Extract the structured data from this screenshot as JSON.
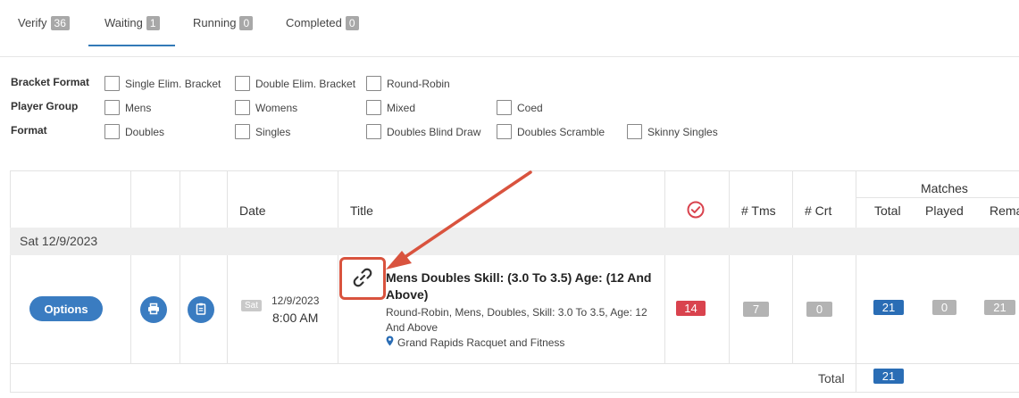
{
  "tabs": [
    {
      "label": "Verify",
      "count": "36"
    },
    {
      "label": "Waiting",
      "count": "1"
    },
    {
      "label": "Running",
      "count": "0"
    },
    {
      "label": "Completed",
      "count": "0"
    }
  ],
  "filters": {
    "bracket_format": {
      "label": "Bracket Format",
      "options": [
        "Single Elim. Bracket",
        "Double Elim. Bracket",
        "Round-Robin"
      ]
    },
    "player_group": {
      "label": "Player Group",
      "options": [
        "Mens",
        "Womens",
        "Mixed",
        "Coed"
      ]
    },
    "format": {
      "label": "Format",
      "options": [
        "Doubles",
        "Singles",
        "Doubles Blind Draw",
        "Doubles Scramble",
        "Skinny Singles"
      ]
    }
  },
  "table": {
    "headers": {
      "date": "Date",
      "title": "Title",
      "teams": "# Tms",
      "courts": "# Crt",
      "matches_group": "Matches",
      "total": "Total",
      "played": "Played",
      "remaining": "Remair"
    },
    "group_label": "Sat 12/9/2023",
    "row": {
      "options_label": "Options",
      "day": "Sat",
      "date": "12/9/2023",
      "time": "8:00 AM",
      "title": "Mens Doubles Skill: (3.0 To 3.5) Age: (12 And Above)",
      "subtitle": "Round-Robin, Mens, Doubles, Skill: 3.0 To 3.5, Age: 12 And Above",
      "venue": "Grand Rapids Racquet and Fitness",
      "verified_count": "14",
      "teams": "7",
      "courts": "0",
      "total": "21",
      "played": "0",
      "remaining": "21"
    },
    "footer": {
      "label": "Total",
      "total": "21"
    }
  },
  "colors": {
    "accent": "#3a7cc1",
    "danger": "#d9434e",
    "annotation": "#d9533e",
    "badge_gray": "#b3b3b3"
  }
}
